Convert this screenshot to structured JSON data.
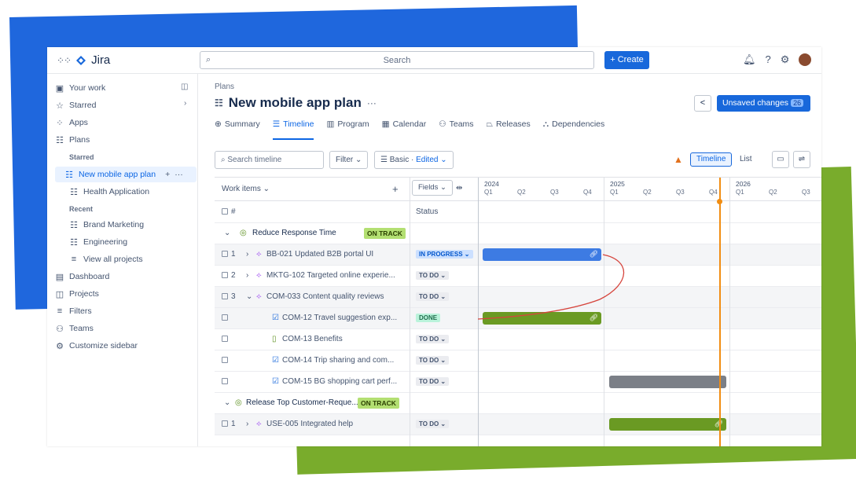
{
  "app": {
    "name": "Jira",
    "search_placeholder": "Search",
    "create_label": "+ Create"
  },
  "sidebar": {
    "items": [
      {
        "icon": "your-work-icon",
        "glyph": "▣",
        "label": "Your work"
      },
      {
        "icon": "star-icon",
        "glyph": "☆",
        "label": "Starred"
      },
      {
        "icon": "apps-icon",
        "glyph": "⁘",
        "label": "Apps"
      },
      {
        "icon": "plans-icon",
        "glyph": "☷",
        "label": "Plans"
      }
    ],
    "starred_section": "Starred",
    "starred_items": [
      "New mobile app plan",
      "Health Application"
    ],
    "recent_section": "Recent",
    "recent_items": [
      "Brand Marketing",
      "Engineering"
    ],
    "view_all": "View all projects",
    "bottom_items": [
      {
        "icon": "dashboard-icon",
        "glyph": "▤",
        "label": "Dashboard"
      },
      {
        "icon": "projects-icon",
        "glyph": "◫",
        "label": "Projects"
      },
      {
        "icon": "filter-icon",
        "glyph": "≡",
        "label": "Filters"
      },
      {
        "icon": "teams-icon",
        "glyph": "⚇",
        "label": "Teams"
      },
      {
        "icon": "customize-icon",
        "glyph": "⚙",
        "label": "Customize sidebar"
      }
    ]
  },
  "header": {
    "breadcrumb": "Plans",
    "title": "New mobile app plan",
    "more": "···",
    "unsaved_label": "Unsaved changes",
    "unsaved_count": "26"
  },
  "tabs": [
    "Summary",
    "Timeline",
    "Program",
    "Calendar",
    "Teams",
    "Releases",
    "Dependencies"
  ],
  "toolbar": {
    "search_placeholder": "Search timeline",
    "filter_label": "Filter ⌄",
    "basic_label": "Basic · ",
    "edited_label": "Edited ⌄",
    "timeline_label": "Timeline",
    "list_label": "List"
  },
  "grid": {
    "work_items_header": "Work items ⌄",
    "fields_label": "Fields ⌄",
    "hash": "#",
    "status_header": "Status",
    "years": [
      "2024",
      "2025",
      "2026"
    ],
    "quarters": [
      "Q1",
      "Q2",
      "Q3",
      "Q4"
    ],
    "rows": [
      {
        "type": "group",
        "text": "Reduce Response Time",
        "badge": "ON TRACK"
      },
      {
        "type": "item",
        "num": "1",
        "text": "BB-021 Updated B2B portal UI",
        "status": "IN PROGRESS ⌄"
      },
      {
        "type": "item",
        "num": "2",
        "text": "MKTG-102 Targeted online experie...",
        "status": "TO DO ⌄"
      },
      {
        "type": "item",
        "num": "3",
        "text": "COM-033 Content quality reviews",
        "status": "TO DO ⌄"
      },
      {
        "type": "child",
        "text": "COM-12 Travel suggestion exp...",
        "status": "DONE"
      },
      {
        "type": "child",
        "text": "COM-13 Benefits",
        "status": "TO DO ⌄"
      },
      {
        "type": "child",
        "text": "COM-14 Trip sharing and com...",
        "status": "TO DO ⌄"
      },
      {
        "type": "child",
        "text": "COM-15 BG shopping cart perf...",
        "status": "TO DO ⌄"
      },
      {
        "type": "group",
        "text": "Release Top Customer-Reque...",
        "badge": "ON TRACK"
      },
      {
        "type": "item",
        "num": "1",
        "text": "USE-005 Integrated help",
        "status": "TO DO ⌄"
      }
    ]
  },
  "colors": {
    "accent": "#1868db",
    "bar_blue": "#3d7be3",
    "bar_green": "#6a9a23",
    "bar_gray": "#7b7f87",
    "today": "#f18d13",
    "dependency": "#d6453d"
  }
}
